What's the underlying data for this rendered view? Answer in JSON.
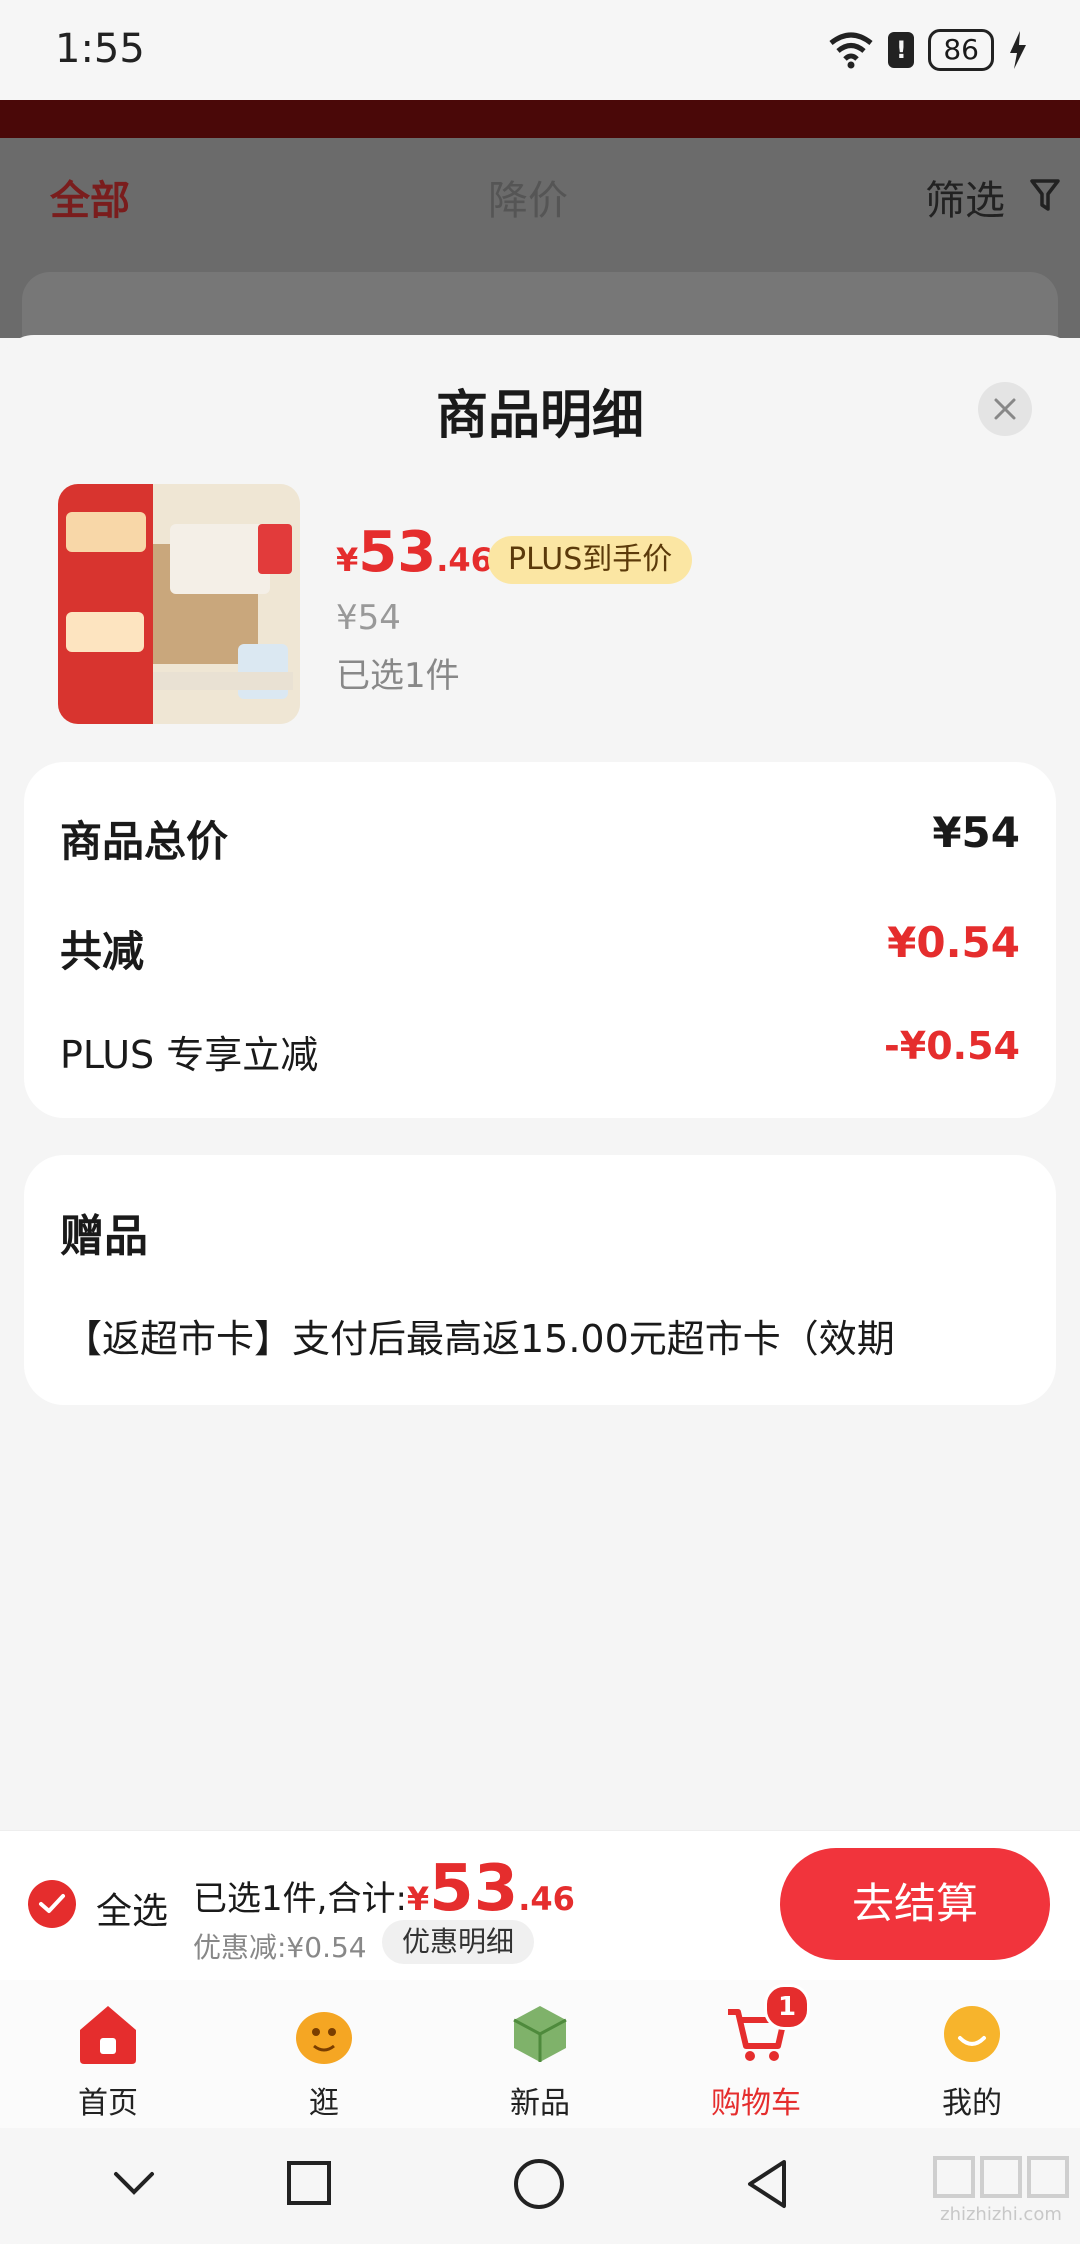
{
  "status_bar": {
    "time": "1:55",
    "battery": "86"
  },
  "background": {
    "tabs": [
      "全部",
      "降价"
    ],
    "filter_label": "筛选"
  },
  "sheet": {
    "title": "商品明细",
    "product": {
      "price_currency": "¥",
      "price_int": "53",
      "price_dec": ".46",
      "plus_badge": "PLUS到手价",
      "original_price": "¥54",
      "selected_count": "已选1件"
    },
    "price_card": {
      "total_label": "商品总价",
      "total_value": "¥54",
      "reduce_label": "共减",
      "reduce_value": "¥0.54",
      "plus_label": "PLUS 专享立减",
      "plus_value": "-¥0.54"
    },
    "gift_card": {
      "title": "赠品",
      "text": "【返超市卡】支付后最高返15.00元超市卡（效期"
    }
  },
  "checkout": {
    "select_all": "全选",
    "summary_prefix": "已选1件,合计:",
    "total_currency": "¥",
    "total_int": "53",
    "total_dec": ".46",
    "discount": "优惠减:¥0.54",
    "detail_button": "优惠明细",
    "checkout_button": "去结算"
  },
  "tabbar": {
    "items": [
      {
        "label": "首页",
        "icon": "home-icon"
      },
      {
        "label": "逛",
        "icon": "stroll-icon"
      },
      {
        "label": "新品",
        "icon": "new-product-icon"
      },
      {
        "label": "购物车",
        "icon": "cart-icon",
        "active": true
      },
      {
        "label": "我的",
        "icon": "profile-icon"
      }
    ],
    "cart_badge": "1"
  },
  "colors": {
    "accent": "#e52d2d",
    "checkout_button": "#f1343c",
    "plus_badge_bg": "#fbe6a3"
  },
  "watermark": {
    "text": "zhizhizhi.com"
  }
}
